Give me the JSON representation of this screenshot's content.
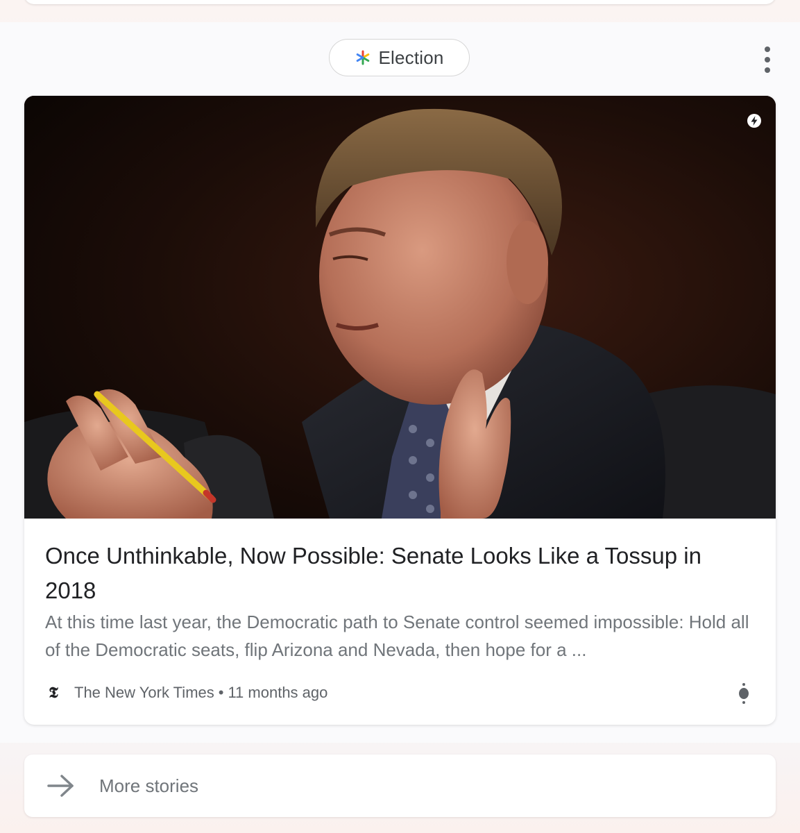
{
  "topic_chip": {
    "label": "Election",
    "icon": "google-multicolor-asterisk-icon"
  },
  "section_menu": {
    "icon": "more-vert-icon"
  },
  "article": {
    "image_alt": "Senator speaking and gesturing with both hands while holding a yellow pencil",
    "amp_badge": "amp-lightning-icon",
    "headline": "Once Unthinkable, Now Possible: Senate Looks Like a Tossup in 2018",
    "snippet": "At this time last year, the Democratic path to Senate control seemed impossible: Hold all of the Democratic seats, flip Arizona and Nevada, then hope for a ...",
    "source": {
      "logo": "nyt-logo-icon",
      "name": "The New York Times",
      "separator": "•",
      "time": "11 months ago"
    },
    "menu_icon": "more-vert-icon"
  },
  "more_stories": {
    "icon": "arrow-right-icon",
    "label": "More stories"
  },
  "colors": {
    "headline": "#202124",
    "snippet": "#70757a",
    "chip_border": "#d6d6d6",
    "icon_gray": "#5f6368"
  }
}
